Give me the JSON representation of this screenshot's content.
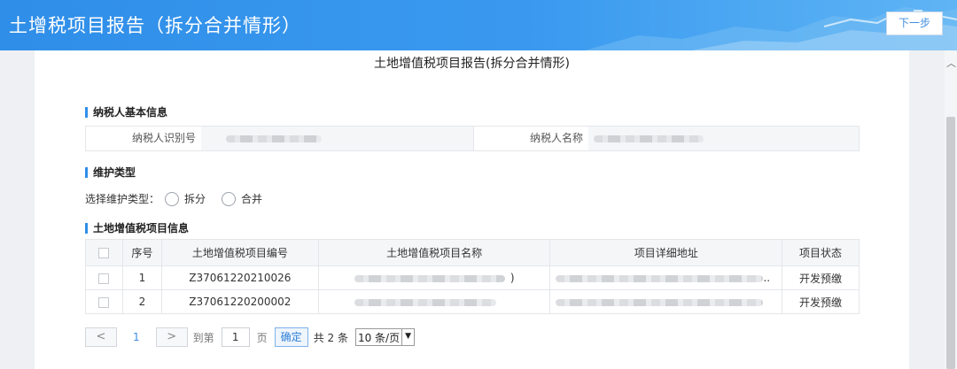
{
  "header": {
    "title": "土增税项目报告（拆分合并情形）",
    "next_label": "下一步"
  },
  "report_title": "土地增值税项目报告(拆分合并情形)",
  "taxpayer": {
    "section_label": "纳税人基本信息",
    "id_label": "纳税人识别号",
    "name_label": "纳税人名称"
  },
  "maintenance": {
    "section_label": "维护类型",
    "prompt": "选择维护类型：",
    "options": [
      "拆分",
      "合并"
    ]
  },
  "projects": {
    "section_label": "土地增值税项目信息",
    "columns": [
      "序号",
      "土地增值税项目编号",
      "土地增值税项目名称",
      "项目详细地址",
      "项目状态"
    ],
    "rows": [
      {
        "seq": "1",
        "code": "Z37061220210026",
        "name_suffix": ")",
        "addr_suffix": "..",
        "status": "开发预缴"
      },
      {
        "seq": "2",
        "code": "Z37061220200002",
        "name_suffix": "",
        "addr_suffix": "",
        "status": "开发预缴"
      }
    ]
  },
  "pager": {
    "prev": "<",
    "page": "1",
    "next": ">",
    "goto_label": "到第",
    "goto_value": "1",
    "page_unit": "页",
    "confirm": "确定",
    "total": "共 2 条",
    "page_size": "10 条/页"
  },
  "colors": {
    "accent": "#2f8ee8",
    "header_bg": "#3a99ef"
  }
}
